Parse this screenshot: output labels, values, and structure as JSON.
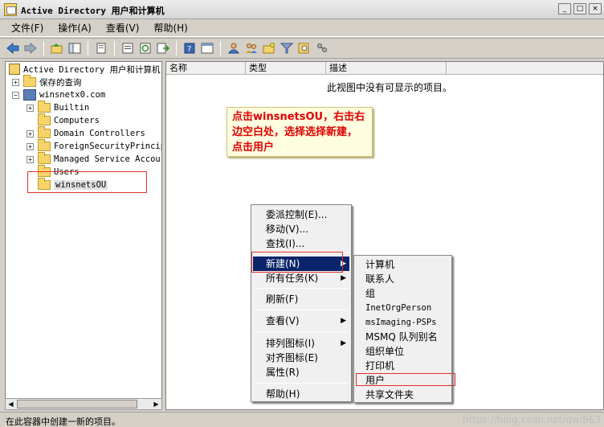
{
  "window": {
    "title": "Active Directory 用户和计算机",
    "minimize": "_",
    "maximize": "□",
    "close": "×"
  },
  "menubar": [
    "文件(F)",
    "操作(A)",
    "查看(V)",
    "帮助(H)"
  ],
  "toolbar": {
    "icons": [
      "back-icon",
      "forward-icon",
      "up-icon",
      "console-tree-icon",
      "copy-icon",
      "properties-icon",
      "refresh-icon",
      "export-icon",
      "help-icon",
      "show-hide-icon",
      "users-icon",
      "groups-icon",
      "new-ou-icon",
      "filter-icon",
      "find-icon",
      "delegate-icon"
    ]
  },
  "tree": {
    "root": "Active Directory 用户和计算机",
    "items": [
      {
        "label": "保存的查询",
        "expand": "+"
      },
      {
        "label": "winsnetx0.com",
        "expand": "−"
      },
      {
        "label": "Builtin",
        "expand": "+"
      },
      {
        "label": "Computers",
        "expand": ""
      },
      {
        "label": "Domain Controllers",
        "expand": "+"
      },
      {
        "label": "ForeignSecurityPrincip",
        "expand": "+"
      },
      {
        "label": "Managed Service Accou",
        "expand": "+"
      },
      {
        "label": "Users",
        "expand": ""
      },
      {
        "label": "winsnetsOU",
        "expand": ""
      }
    ]
  },
  "list": {
    "columns": [
      "名称",
      "类型",
      "描述"
    ],
    "empty_message": "此视图中没有可显示的项目。"
  },
  "annotation": {
    "text": "点击winsnetsOU，右击右边空白处，选择选择新建，点击用户"
  },
  "context_menu": {
    "items": [
      {
        "label": "委派控制(E)...",
        "arrow": ""
      },
      {
        "label": "移动(V)...",
        "arrow": ""
      },
      {
        "label": "查找(I)...",
        "arrow": ""
      },
      {
        "label": "新建(N)",
        "arrow": "▶"
      },
      {
        "label": "所有任务(K)",
        "arrow": "▶"
      },
      {
        "label": "刷新(F)",
        "arrow": ""
      },
      {
        "label": "查看(V)",
        "arrow": "▶"
      },
      {
        "label": "排列图标(I)",
        "arrow": "▶"
      },
      {
        "label": "对齐图标(E)",
        "arrow": ""
      },
      {
        "label": "属性(R)",
        "arrow": ""
      },
      {
        "label": "帮助(H)",
        "arrow": ""
      }
    ]
  },
  "submenu": {
    "items": [
      "计算机",
      "联系人",
      "组",
      "InetOrgPerson",
      "msImaging-PSPs",
      "MSMQ 队列别名",
      "组织单位",
      "打印机",
      "用户",
      "共享文件夹"
    ]
  },
  "status": {
    "text": "在此容器中创建一新的项目。",
    "watermark": "https://blog.csdn.net/qwl863"
  }
}
